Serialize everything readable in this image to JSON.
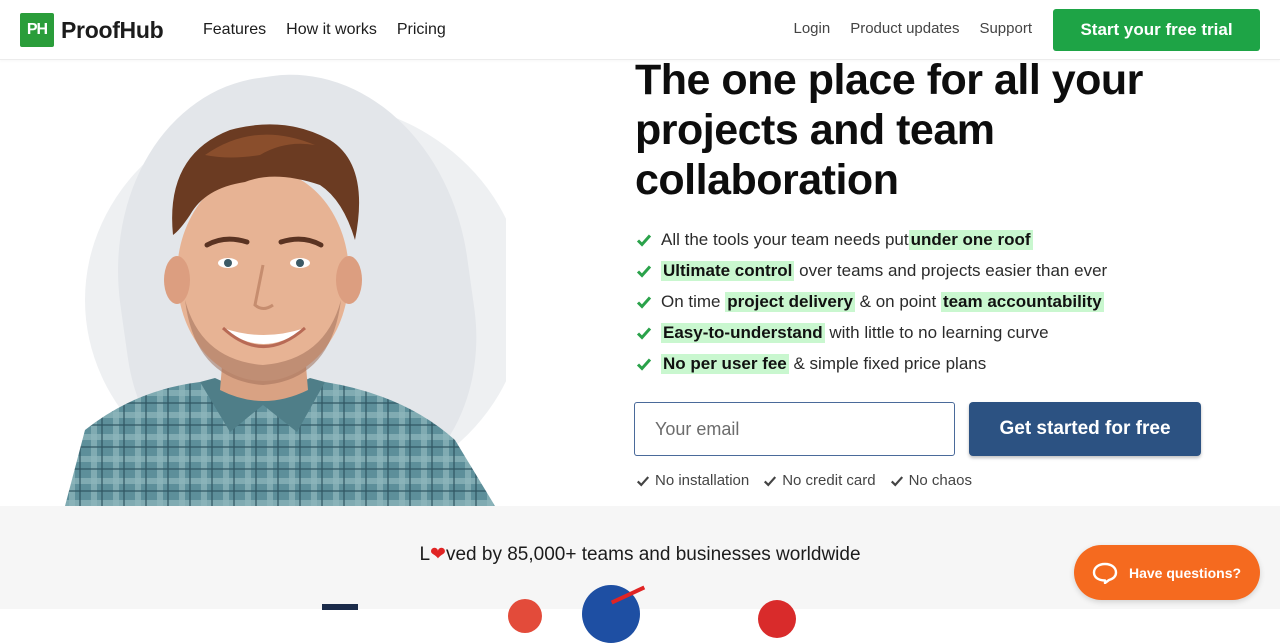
{
  "header": {
    "logo_mark": "PH",
    "logo_text": "ProofHub",
    "nav_left": [
      "Features",
      "How it works",
      "Pricing"
    ],
    "nav_right": [
      "Login",
      "Product updates",
      "Support"
    ],
    "trial_button": "Start your free trial"
  },
  "hero": {
    "headline": "The one place for all your projects and team collaboration",
    "features": [
      {
        "before": "All the tools your team needs put ",
        "highlight": "under one roof",
        "after": ""
      },
      {
        "before": "",
        "highlight": "Ultimate control",
        "after": " over teams and projects easier than ever"
      },
      {
        "before": "On time ",
        "highlight": "project delivery",
        "after": " & on point ",
        "highlight2": "team accountability"
      },
      {
        "before": "",
        "highlight": "Easy-to-understand",
        "after": " with little to no learning curve"
      },
      {
        "before": "",
        "highlight": "No per user fee",
        "after": " & simple fixed price plans"
      }
    ],
    "email_placeholder": "Your email",
    "cta_button": "Get started for free",
    "perks": [
      "No installation",
      "No credit card",
      "No chaos"
    ]
  },
  "social_proof": {
    "loved_prefix": "L",
    "loved_suffix": "ved by 85,000+ teams and businesses worldwide"
  },
  "chat": {
    "label": "Have questions?"
  },
  "colors": {
    "brand_green": "#1ea446",
    "cta_blue": "#2c5282",
    "highlight": "#c9f7cf",
    "chat_orange": "#f56a1f"
  }
}
